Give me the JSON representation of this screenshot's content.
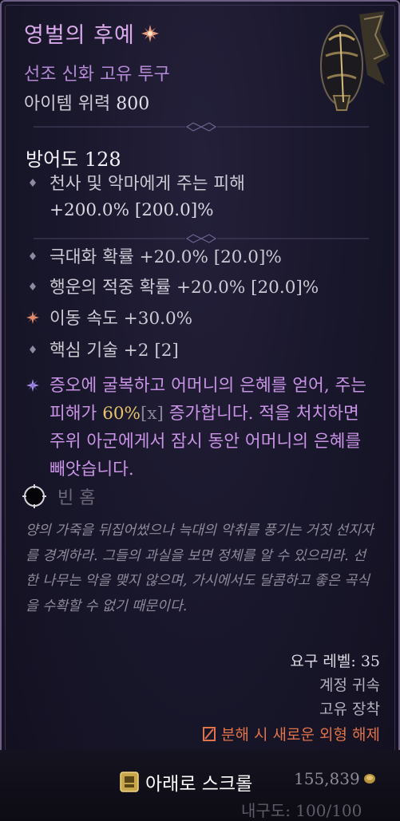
{
  "item": {
    "name": "영벌의 후예",
    "subtitle": "선조 신화 고유 투구",
    "power_label": "아이템 위력",
    "power_value": "800"
  },
  "stats": {
    "armor": "방어도 128",
    "implicit_1": "천사 및 악마에게 주는 피해",
    "implicit_1_value": "+200.0% [200.0]%",
    "affix_1": "극대화 확률 +20.0% [20.0]%",
    "affix_2": "행운의 적중 확률 +20.0% [20.0]%",
    "affix_3": "이동 속도 +30.0%",
    "affix_4": "핵심 기술 +2 [2]"
  },
  "unique_power": {
    "text_a": "증오에 굴복하고 어머니의 은혜를 얻어, 주는 피해가 ",
    "value": "60%",
    "bracket": "[x]",
    "text_b": " 증가합니다. 적을 처치하면 주위 아군에게서 잠시 동안 어머니의 은혜를 빼앗습니다."
  },
  "socket": {
    "label": "빈 홈"
  },
  "flavor_text": "양의 가죽을 뒤집어썼으나 늑대의 악취를 풍기는 거짓 선지자를 경계하라. 그들의 과실을 보면 정체를 알 수 있으리라. 선한 나무는 악을 맺지 않으며, 가시에서도 달콤하고 좋은 곡식을 수확할 수 없기 때문이다.",
  "requirements": {
    "level": "요구 레벨: 35",
    "bound": "계정 귀속",
    "slot": "고유 장착",
    "salvage": "분해 시 새로운 외형 해제"
  },
  "footer": {
    "scroll_label": "아래로 스크롤",
    "gold": "155,839",
    "durability": "내구도: 100/100"
  },
  "colors": {
    "mythic_name": "#d9a9ec",
    "unique_text": "#c993e6",
    "highlight": "#e7c46a",
    "salvage": "#e0734a"
  }
}
